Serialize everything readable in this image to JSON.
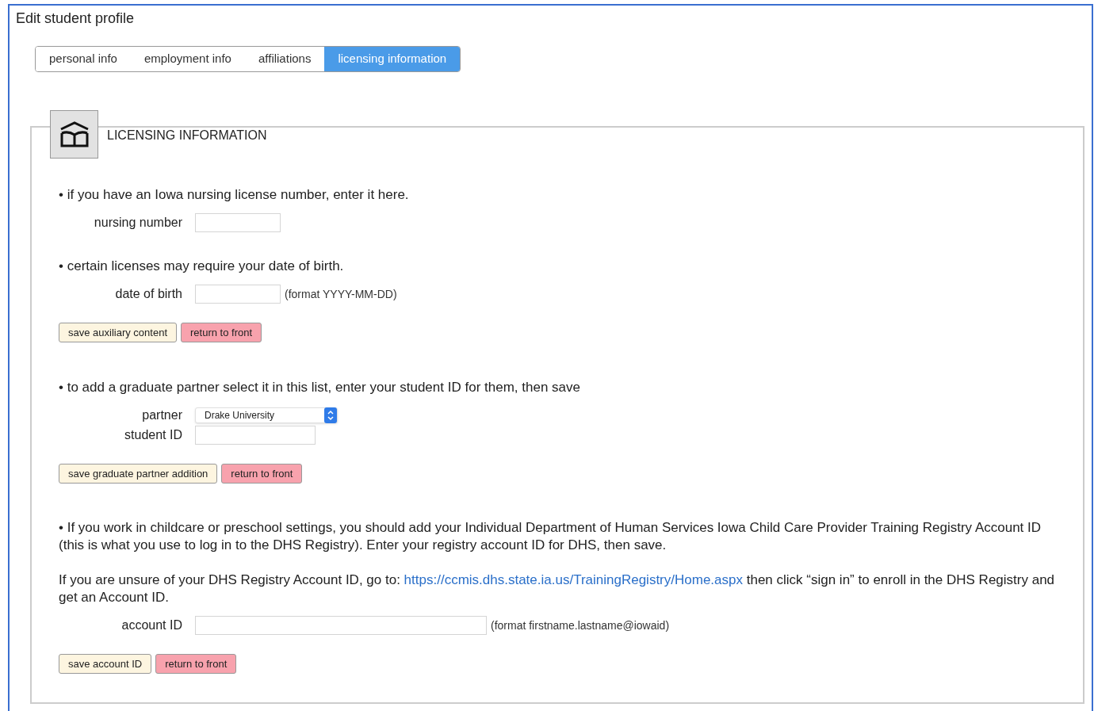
{
  "title": "Edit student profile",
  "tabs": [
    {
      "label": "personal info",
      "selected": false
    },
    {
      "label": "employment info",
      "selected": false
    },
    {
      "label": "affiliations",
      "selected": false
    },
    {
      "label": "licensing information",
      "selected": true
    }
  ],
  "section": {
    "heading": "LICENSING INFORMATION",
    "items": [
      {
        "kind": "bullet",
        "text": "• if you have an Iowa nursing license number, enter it here."
      },
      {
        "kind": "field",
        "label": "nursing number"
      },
      {
        "kind": "bullet",
        "text": "• certain licenses may require your date of birth."
      },
      {
        "kind": "field",
        "label": "date of birth",
        "hint": "(format YYYY-MM-DD)"
      },
      {
        "kind": "buttons",
        "buttons": [
          {
            "label": "save auxiliary content",
            "kind": "save"
          },
          {
            "label": "return to front",
            "kind": "return"
          }
        ]
      },
      {
        "kind": "bullet",
        "text": "• to add a graduate partner select it in this list, enter your student ID for them, then save"
      },
      {
        "kind": "select",
        "label": "partner",
        "value": "Drake University"
      },
      {
        "kind": "field",
        "label": "student ID"
      },
      {
        "kind": "buttons",
        "buttons": [
          {
            "label": "save graduate partner addition",
            "kind": "save"
          },
          {
            "label": "return to front",
            "kind": "return"
          }
        ]
      },
      {
        "kind": "paragraph",
        "text": "• If you work in childcare or preschool settings, you should add your Individual Department of Human Services Iowa Child Care Provider Training Registry Account ID (this is what you use to log in to the DHS Registry). Enter your registry account ID for DHS, then save."
      },
      {
        "kind": "paragraph",
        "text": "If you are unsure of your DHS Registry Account ID, go to:",
        "link": "https://ccmis.dhs.state.ia.us/TrainingRegistry/Home.aspx",
        "after": "then click “sign in” to enroll in the DHS Registry and get an Account ID."
      },
      {
        "kind": "field",
        "label": "account ID",
        "hint": "(format firstname.lastname@iowaid)"
      },
      {
        "kind": "buttons",
        "buttons": [
          {
            "label": "save account ID",
            "kind": "save"
          },
          {
            "label": "return to front",
            "kind": "return"
          }
        ]
      }
    ]
  }
}
